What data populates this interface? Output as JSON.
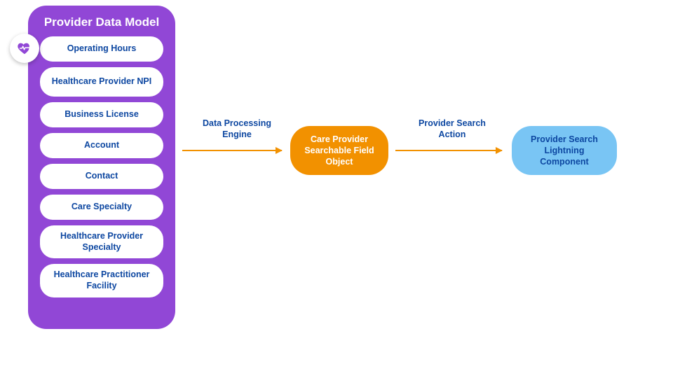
{
  "colors": {
    "purple": "#9147D6",
    "orange": "#F29100",
    "blue_fill": "#79C5F4",
    "text_blue": "#0D47A1"
  },
  "purple_box": {
    "title": "Provider Data Model",
    "items": [
      "Operating Hours",
      "Healthcare Provider NPI",
      "Business License",
      "Account",
      "Contact",
      "Care Specialty",
      "Healthcare Provider Specialty",
      "Healthcare Practitioner Facility"
    ]
  },
  "arrow1_label": "Data Processing\nEngine",
  "orange_node": "Care Provider Searchable Field Object",
  "arrow2_label": "Provider Search\nAction",
  "blue_node": "Provider Search Lightning Component",
  "icon": {
    "heart": "heart-pulse-icon"
  }
}
